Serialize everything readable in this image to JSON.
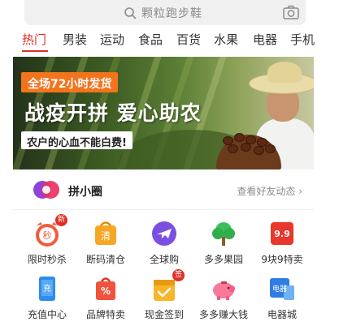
{
  "search": {
    "placeholder": "颗粒跑步鞋",
    "icon": "search-icon",
    "camera_icon": "camera-icon"
  },
  "tabs": [
    {
      "label": "热门",
      "active": true
    },
    {
      "label": "男装",
      "active": false
    },
    {
      "label": "运动",
      "active": false
    },
    {
      "label": "食品",
      "active": false
    },
    {
      "label": "百货",
      "active": false
    },
    {
      "label": "水果",
      "active": false
    },
    {
      "label": "电器",
      "active": false
    },
    {
      "label": "手机",
      "active": false
    }
  ],
  "banner": {
    "badge": "全场72小时发货",
    "title": "战疫开拼 爱心助农",
    "subtitle": "农户的心血不能白费!"
  },
  "pin_xiao_quan": {
    "title": "拼小圈",
    "link": "查看好友动态"
  },
  "grid": {
    "row1": [
      {
        "label": "限时秒杀",
        "icon": "alarm-clock-icon",
        "icon_text": "秒",
        "badge": "新"
      },
      {
        "label": "断码清仓",
        "icon": "clearance-bag-icon",
        "icon_text": "清"
      },
      {
        "label": "全球购",
        "icon": "airplane-icon"
      },
      {
        "label": "多多果园",
        "icon": "tree-icon"
      },
      {
        "label": "9块9特卖",
        "icon": "price-tag-icon",
        "icon_text": "9.9"
      }
    ],
    "row2": [
      {
        "label": "充值中心",
        "icon": "phone-recharge-icon",
        "icon_text": "充"
      },
      {
        "label": "品牌特卖",
        "icon": "discount-bag-icon",
        "icon_text": "%"
      },
      {
        "label": "现金签到",
        "icon": "calendar-check-icon",
        "badge": "签"
      },
      {
        "label": "多多赚大钱",
        "icon": "piggy-bank-icon"
      },
      {
        "label": "电器城",
        "icon": "appliance-icon",
        "icon_text": "电器"
      }
    ]
  },
  "colors": {
    "accent": "#e02e24",
    "orange": "#f4741d"
  }
}
